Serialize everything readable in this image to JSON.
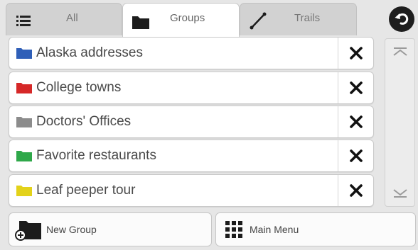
{
  "tabs": [
    {
      "label": "All",
      "icon": "list-icon",
      "active": false
    },
    {
      "label": "Groups",
      "icon": "folder-icon",
      "active": true
    },
    {
      "label": "Trails",
      "icon": "trail-icon",
      "active": false
    }
  ],
  "back_button": {
    "icon": "back-arrow-icon"
  },
  "groups": [
    {
      "label": "Alaska addresses",
      "color": "#2f5fb8"
    },
    {
      "label": "College towns",
      "color": "#d62828"
    },
    {
      "label": "Doctors' Offices",
      "color": "#8c8c8c"
    },
    {
      "label": "Favorite restaurants",
      "color": "#2fa84a"
    },
    {
      "label": "Leaf peeper tour",
      "color": "#e3d21a"
    }
  ],
  "scroll": {
    "up_icon": "scroll-top-icon",
    "down_icon": "scroll-down-icon"
  },
  "footer": {
    "new_group_label": "New Group",
    "main_menu_label": "Main Menu"
  }
}
